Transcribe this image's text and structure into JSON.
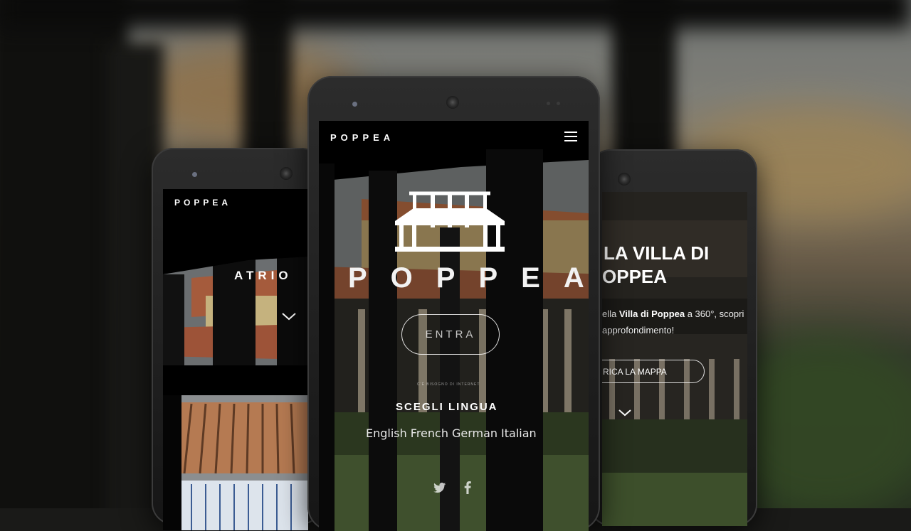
{
  "left_screen": {
    "brand": "POPPEA",
    "section_title": "ATRIO",
    "down_icon": "chevron-down-icon"
  },
  "center_screen": {
    "brand": "POPPEA",
    "menu_icon": "hamburger-menu-icon",
    "logo_icon": "temple-villa-icon",
    "hero_title": "POPPEA",
    "enter_button": "ENTRA",
    "small_note": "C'È BISOGNO DI INTERNET",
    "language_heading": "SCEGLI LINGUA",
    "languages": [
      "English",
      "French",
      "German",
      "Italian"
    ],
    "social_icons": [
      "twitter-icon",
      "facebook-icon"
    ]
  },
  "right_screen": {
    "title_line1": "LA VILLA DI",
    "title_line2": "OPPEA",
    "text_prefix": "ella ",
    "text_bold": "Villa di Poppea",
    "text_suffix": " a 360°, scopri",
    "text_line2": "approfondimento!",
    "map_button": "RICA LA MAPPA",
    "down_icon": "chevron-down-icon"
  },
  "colors": {
    "screen_bg": "#000000",
    "text": "#ffffff",
    "roof_tile": "#b2643f",
    "wall_ochre": "#c9b07a",
    "grass": "#4b6a34"
  }
}
